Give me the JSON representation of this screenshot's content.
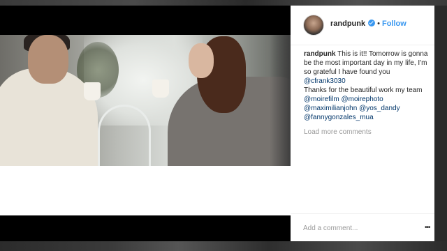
{
  "post": {
    "username": "randpunk",
    "follow_label": "Follow",
    "separator": "•"
  },
  "caption": {
    "author": "randpunk",
    "text_1": "This is it!! Tomorrow is gonna be the most important day in my life, I'm so grateful I have found you",
    "mention_1": "@cfrank3030",
    "text_2": "Thanks for the beautiful work my team",
    "mentions": [
      "@moirefilm",
      "@moirephoto",
      "@maximilianjohn",
      "@yos_dandy",
      "@fannygonzales_mua"
    ]
  },
  "comments": {
    "load_more_label": "Load more comments"
  },
  "add_comment": {
    "placeholder": "Add a comment..."
  },
  "icons": {
    "verified": "verified-badge-icon",
    "more": "more-options-icon"
  },
  "colors": {
    "link_blue": "#3897f0",
    "mention_blue": "#003569",
    "muted_gray": "#999999"
  }
}
